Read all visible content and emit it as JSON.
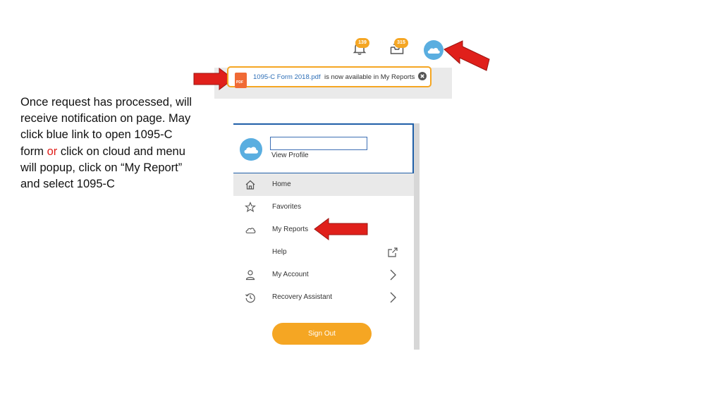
{
  "instructions": {
    "part1": "Once request has processed, will receive notification on page.  May click blue link to open 1095-C form ",
    "or": "or",
    "part2": " click on cloud and menu will popup, click on “My Report” and select 1095-C"
  },
  "header": {
    "notifications_count": "139",
    "inbox_count": "315"
  },
  "notification": {
    "file_badge": "PDF",
    "link_text": "1095-C Form 2018.pdf",
    "message": "is now available in My Reports"
  },
  "menu": {
    "view_profile": "View Profile",
    "items": [
      {
        "label": "Home",
        "icon": "home-icon"
      },
      {
        "label": "Favorites",
        "icon": "star-icon"
      },
      {
        "label": "My Reports",
        "icon": "cloud-icon"
      },
      {
        "label": "Help",
        "icon": "external-link-icon"
      },
      {
        "label": "My Account",
        "icon": "user-icon"
      },
      {
        "label": "Recovery Assistant",
        "icon": "history-icon"
      }
    ],
    "sign_out": "Sign Out"
  },
  "colors": {
    "accent": "#f5a623",
    "link": "#2e6fb7",
    "highlight_border": "#1f5fa8",
    "arrow": "#e0201b",
    "avatar": "#5aaee0"
  }
}
